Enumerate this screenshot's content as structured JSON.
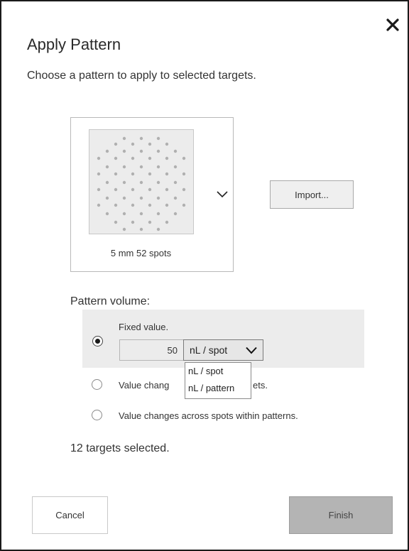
{
  "dialog": {
    "title": "Apply Pattern",
    "subtitle": "Choose a pattern to apply to selected targets.",
    "close_icon": "close-icon"
  },
  "pattern": {
    "selected_label": "5 mm 52 spots",
    "thumbnail_icon": "spot-pattern-icon",
    "expand_icon": "chevron-down-icon"
  },
  "import": {
    "label": "Import..."
  },
  "volume": {
    "label": "Pattern volume:",
    "options": [
      {
        "label": "Fixed value.",
        "selected": true
      },
      {
        "label": "Value changes across targets.",
        "visible_label": "Value chang",
        "visible_suffix": "ets.",
        "selected": false
      },
      {
        "label": "Value changes across spots within patterns.",
        "selected": false
      }
    ],
    "fixed_value": "50",
    "unit_selected": "nL / spot",
    "unit_options": [
      "nL / spot",
      "nL / pattern"
    ]
  },
  "summary": {
    "text": "12 targets selected."
  },
  "footer": {
    "cancel_label": "Cancel",
    "finish_label": "Finish"
  },
  "colors": {
    "panel_bg": "#ececec",
    "finish_bg": "#b4b4b4",
    "dot": "#b0b0b0"
  }
}
